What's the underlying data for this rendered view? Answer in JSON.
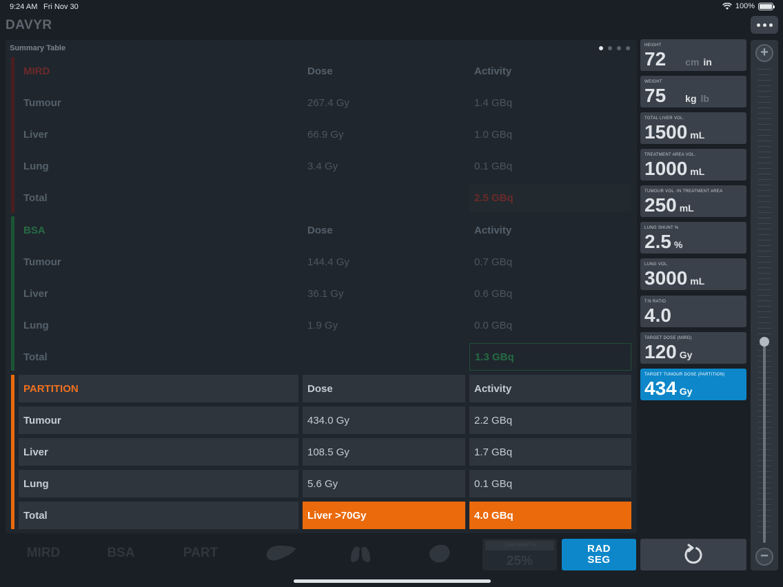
{
  "status_bar": {
    "time": "9:24 AM",
    "date": "Fri Nov 30",
    "battery": "100%"
  },
  "app": {
    "title": "DAVYR"
  },
  "summary": {
    "title": "Summary Table",
    "mird": {
      "header": [
        "MIRD",
        "Dose",
        "Activity"
      ],
      "rows": [
        [
          "Tumour",
          "267.4 Gy",
          "1.4 GBq"
        ],
        [
          "Liver",
          "66.9 Gy",
          "1.0 GBq"
        ],
        [
          "Lung",
          "3.4 Gy",
          "0.1 GBq"
        ],
        [
          "Total",
          "",
          "2.5 GBq"
        ]
      ]
    },
    "bsa": {
      "header": [
        "BSA",
        "Dose",
        "Activity"
      ],
      "rows": [
        [
          "Tumour",
          "144.4 Gy",
          "0.7 GBq"
        ],
        [
          "Liver",
          "36.1 Gy",
          "0.6 GBq"
        ],
        [
          "Lung",
          "1.9 Gy",
          "0.0 GBq"
        ],
        [
          "Total",
          "",
          "1.3 GBq"
        ]
      ]
    },
    "partition": {
      "header": [
        "PARTITION",
        "Dose",
        "Activity"
      ],
      "rows": [
        [
          "Tumour",
          "434.0 Gy",
          "2.2 GBq"
        ],
        [
          "Liver",
          "108.5 Gy",
          "1.7 GBq"
        ],
        [
          "Lung",
          "5.6 Gy",
          "0.1 GBq"
        ],
        [
          "Total",
          "Liver >70Gy",
          "4.0 GBq"
        ]
      ]
    }
  },
  "params": [
    {
      "label": "Height",
      "value": "72",
      "unit_a": "cm",
      "unit_b": "in"
    },
    {
      "label": "Weight",
      "value": "75",
      "unit_a": "kg",
      "unit_b": "lb"
    },
    {
      "label": "Total liver vol.",
      "value": "1500",
      "unit": "mL"
    },
    {
      "label": "Treatment area vol.",
      "value": "1000",
      "unit": "mL"
    },
    {
      "label": "Tumour vol. in treatment area",
      "value": "250",
      "unit": "mL"
    },
    {
      "label": "Lung shunt %",
      "value": "2.5",
      "unit": "%"
    },
    {
      "label": "Lung vol.",
      "value": "3000",
      "unit": "mL"
    },
    {
      "label": "T:N ratio",
      "value": "4.0",
      "unit": ""
    },
    {
      "label": "Target dose (MIRD)",
      "value": "120",
      "unit": "Gy"
    },
    {
      "label": "Target tumour dose (partition)",
      "value": "434",
      "unit": "Gy"
    }
  ],
  "slider": {
    "plus": "+",
    "minus": "−"
  },
  "bottom": {
    "tabs": [
      "MIRD",
      "BSA",
      "PART"
    ],
    "shunt_label": "LUNG SHUNT %",
    "shunt_value": "25%",
    "rad_seg_line1": "RAD",
    "rad_seg_line2": "SEG"
  },
  "colors": {
    "mird": "#7a1f22",
    "bsa": "#1f6b3f",
    "partition": "#ea6a0c",
    "selected": "#0d87c9"
  }
}
